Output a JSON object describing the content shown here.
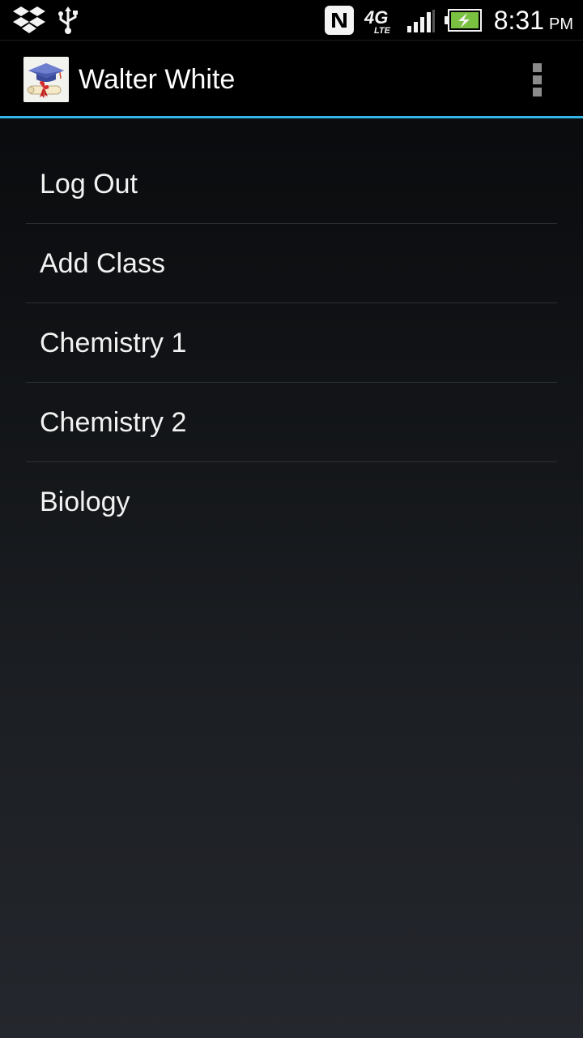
{
  "status_bar": {
    "icons": [
      "dropbox-icon",
      "usb-icon",
      "nfc-icon",
      "4g-lte-icon",
      "signal-icon",
      "battery-charging-icon"
    ],
    "network_label": "4G",
    "network_sublabel": "LTE",
    "time": "8:31",
    "ampm": "PM"
  },
  "action_bar": {
    "title": "Walter White",
    "app_icon": "graduation-cap-diploma-icon",
    "overflow_icon": "overflow-menu-icon",
    "accent_color": "#33b5e5"
  },
  "menu": {
    "items": [
      {
        "label": "Log Out"
      },
      {
        "label": "Add Class"
      },
      {
        "label": "Chemistry 1"
      },
      {
        "label": "Chemistry 2"
      },
      {
        "label": "Biology"
      }
    ]
  }
}
